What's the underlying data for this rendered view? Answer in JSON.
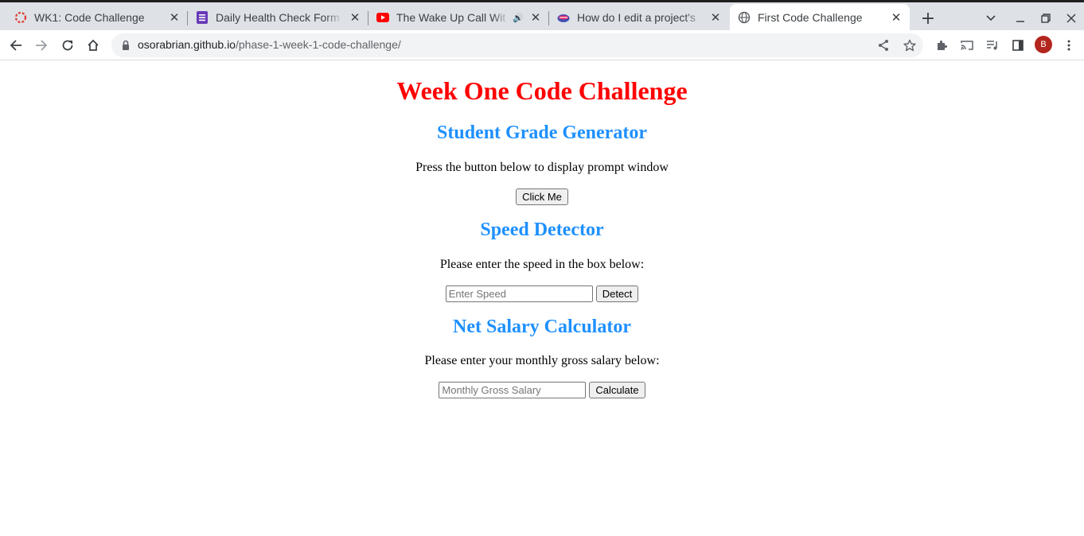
{
  "browser": {
    "tabs": [
      {
        "title": "WK1: Code Challenge",
        "icon": "canvas-icon",
        "active": false
      },
      {
        "title": "Daily Health Check Form",
        "icon": "forms-icon",
        "active": false
      },
      {
        "title": "The Wake Up Call Wit",
        "icon": "youtube-icon",
        "active": false,
        "audio": true
      },
      {
        "title": "How do I edit a project's",
        "icon": "site-icon",
        "active": false
      },
      {
        "title": "First Code Challenge",
        "icon": "globe-icon",
        "active": true
      }
    ],
    "url": {
      "host": "osorabrian.github.io",
      "path": "/phase-1-week-1-code-challenge/"
    },
    "profile_initial": "B",
    "accent": "#b3261e"
  },
  "page": {
    "title": "Week One Code Challenge",
    "title_color": "#ff0000",
    "heading_color": "#1e90ff",
    "grade": {
      "heading": "Student Grade Generator",
      "instruction": "Press the button below to display prompt window",
      "button": "Click Me"
    },
    "speed": {
      "heading": "Speed Detector",
      "instruction": "Please enter the speed in the box below:",
      "placeholder": "Enter Speed",
      "value": "",
      "button": "Detect"
    },
    "salary": {
      "heading": "Net Salary Calculator",
      "instruction": "Please enter your monthly gross salary below:",
      "placeholder": "Monthly Gross Salary",
      "value": "",
      "button": "Calculate"
    }
  }
}
